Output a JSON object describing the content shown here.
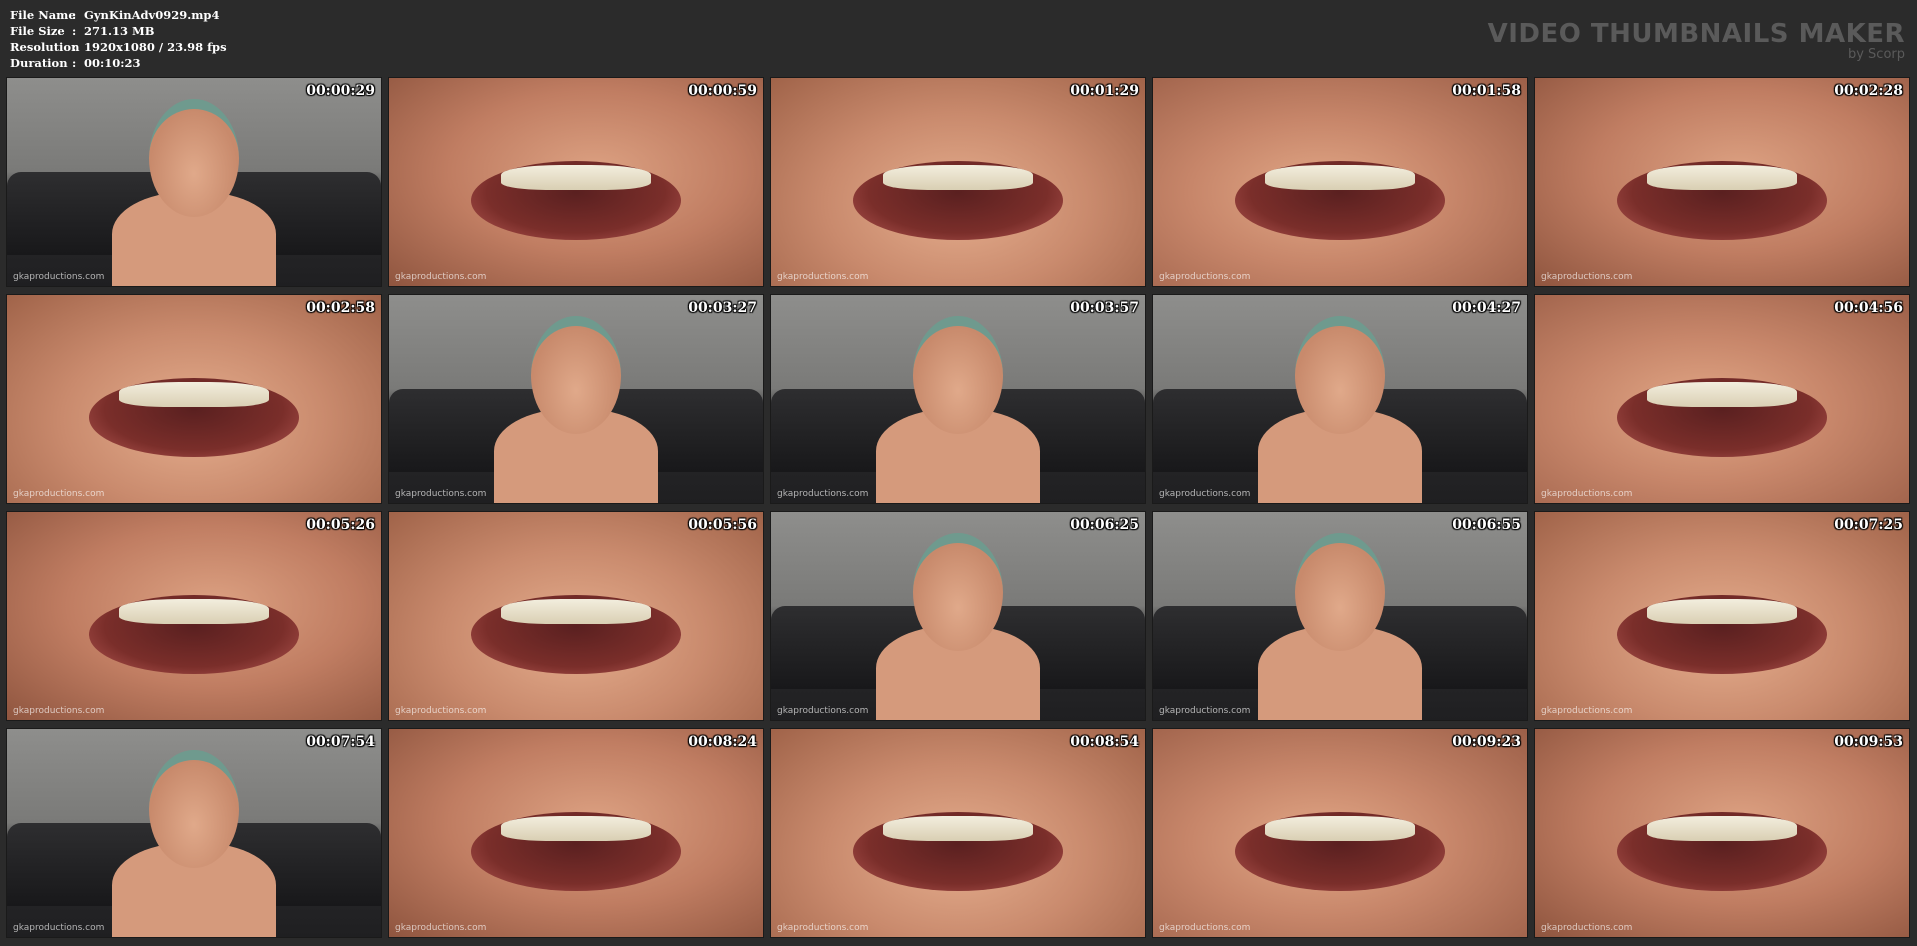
{
  "info": {
    "rows": [
      {
        "key": "File Name",
        "sep": ":",
        "value": "GynKinAdv0929.mp4"
      },
      {
        "key": "File Size",
        "sep": ":",
        "value": "271.13 MB"
      },
      {
        "key": "Resolution",
        "sep": ":",
        "value": "1920x1080 / 23.98 fps"
      },
      {
        "key": "Duration",
        "sep": ":",
        "value": "00:10:23"
      }
    ]
  },
  "brand": {
    "title": "VIDEO THUMBNAILS MAKER",
    "subtitle": "by Scorp"
  },
  "watermark": "gkaproductions.com",
  "thumbnails": [
    {
      "time": "00:00:29",
      "scene": "room"
    },
    {
      "time": "00:00:59",
      "scene": "closeup"
    },
    {
      "time": "00:01:29",
      "scene": "closeup"
    },
    {
      "time": "00:01:58",
      "scene": "closeup"
    },
    {
      "time": "00:02:28",
      "scene": "closeup"
    },
    {
      "time": "00:02:58",
      "scene": "closeup"
    },
    {
      "time": "00:03:27",
      "scene": "room"
    },
    {
      "time": "00:03:57",
      "scene": "room"
    },
    {
      "time": "00:04:27",
      "scene": "room"
    },
    {
      "time": "00:04:56",
      "scene": "closeup"
    },
    {
      "time": "00:05:26",
      "scene": "closeup"
    },
    {
      "time": "00:05:56",
      "scene": "closeup"
    },
    {
      "time": "00:06:25",
      "scene": "room"
    },
    {
      "time": "00:06:55",
      "scene": "room"
    },
    {
      "time": "00:07:25",
      "scene": "closeup"
    },
    {
      "time": "00:07:54",
      "scene": "room"
    },
    {
      "time": "00:08:24",
      "scene": "closeup"
    },
    {
      "time": "00:08:54",
      "scene": "closeup"
    },
    {
      "time": "00:09:23",
      "scene": "closeup"
    },
    {
      "time": "00:09:53",
      "scene": "closeup"
    }
  ]
}
